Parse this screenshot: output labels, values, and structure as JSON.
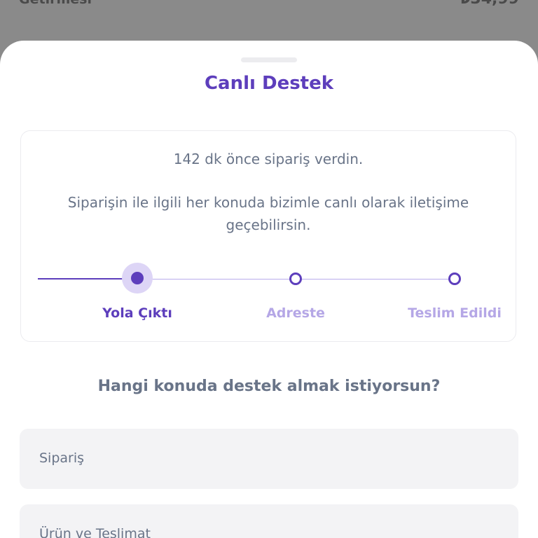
{
  "background": {
    "item_label": "Getirmesi",
    "item_price": "₺34,99"
  },
  "sheet": {
    "title": "Canlı Destek"
  },
  "order_card": {
    "time_text": "142 dk önce sipariş verdin.",
    "description": "Siparişin ile ilgili her konuda bizimle canlı olarak iletişime geçebilirsin.",
    "steps": [
      {
        "label": "Yola Çıktı",
        "state": "current"
      },
      {
        "label": "Adreste",
        "state": "pending"
      },
      {
        "label": "Teslim Edildi",
        "state": "pending"
      }
    ]
  },
  "support": {
    "question": "Hangi konuda destek almak istiyorsun?",
    "options": [
      {
        "label": "Sipariş"
      },
      {
        "label": "Ürün ve Teslimat"
      }
    ]
  },
  "colors": {
    "accent": "#5d3ebc",
    "accent_light": "#b5a7e6",
    "text_secondary": "#697488",
    "option_bg": "#f3f3f5"
  }
}
